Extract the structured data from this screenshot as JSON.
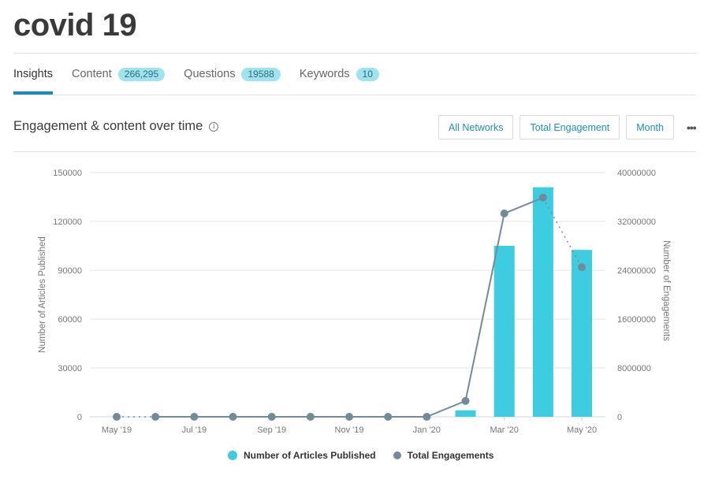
{
  "page": {
    "title": "covid 19"
  },
  "tabs": [
    {
      "label": "Insights",
      "badge": null,
      "active": true
    },
    {
      "label": "Content",
      "badge": "266,295",
      "active": false
    },
    {
      "label": "Questions",
      "badge": "19588",
      "active": false
    },
    {
      "label": "Keywords",
      "badge": "10",
      "active": false
    }
  ],
  "section": {
    "title": "Engagement & content over time",
    "info_icon": "info-icon",
    "controls": [
      "All Networks",
      "Total Engagement",
      "Month"
    ],
    "more_icon": "more-horizontal-icon"
  },
  "colors": {
    "articles": "#3ecde0",
    "engagements": "#738b99",
    "accent": "#1a8bb8"
  },
  "chart_data": {
    "type": "bar+line",
    "title": "Engagement & content over time",
    "categories": [
      "May '19",
      "Jun '19",
      "Jul '19",
      "Aug '19",
      "Sep '19",
      "Oct '19",
      "Nov '19",
      "Dec '19",
      "Jan '20",
      "Feb '20",
      "Mar '20",
      "Apr '20",
      "May '20"
    ],
    "x_tick_labels": [
      "May '19",
      "Jul '19",
      "Sep '19",
      "Nov '19",
      "Jan '20",
      "Mar '20",
      "May '20"
    ],
    "series": [
      {
        "name": "Number of Articles Published",
        "type": "bar",
        "axis": "left",
        "values": [
          0,
          0,
          0,
          0,
          0,
          0,
          0,
          0,
          0,
          4000,
          105000,
          141000,
          102500
        ]
      },
      {
        "name": "Total Engagements",
        "type": "line",
        "axis": "right",
        "values": [
          0,
          0,
          0,
          0,
          0,
          0,
          0,
          0,
          0,
          2600000,
          33300000,
          35900000,
          24500000
        ],
        "dotted_segments": [
          [
            0,
            1
          ],
          [
            11,
            12
          ]
        ]
      }
    ],
    "ylabel": "Number of Articles Published",
    "y2label": "Number of Engagements",
    "ylim": [
      0,
      150000
    ],
    "y2lim": [
      0,
      40000000
    ],
    "yticks": [
      0,
      30000,
      60000,
      90000,
      120000,
      150000
    ],
    "y2ticks": [
      0,
      8000000,
      16000000,
      24000000,
      32000000,
      40000000
    ],
    "grid": true,
    "legend": "bottom-center"
  }
}
